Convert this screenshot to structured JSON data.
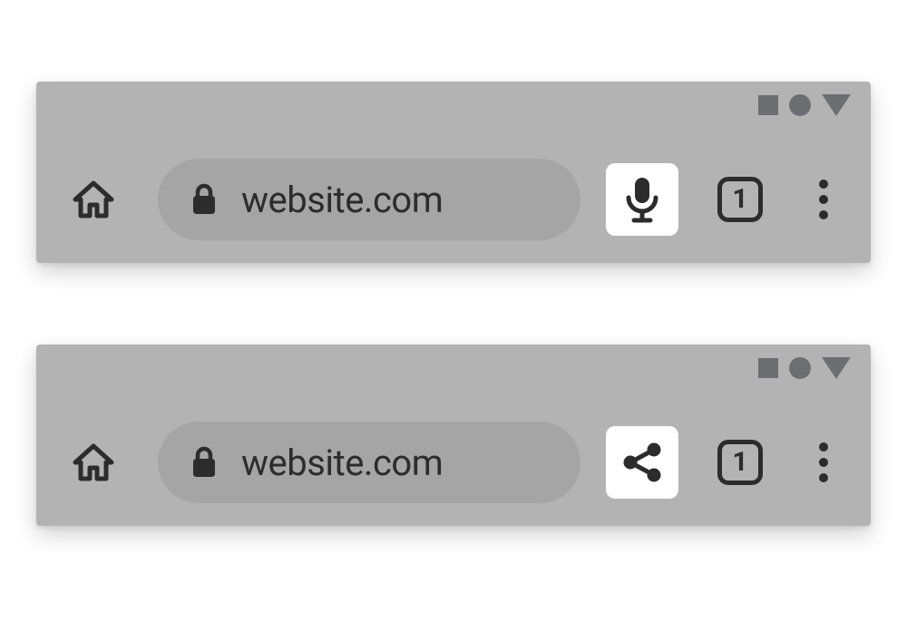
{
  "toolbars": [
    {
      "url": "website.com",
      "tab_count": "1",
      "action_icon": "microphone-icon"
    },
    {
      "url": "website.com",
      "tab_count": "1",
      "action_icon": "share-icon"
    }
  ],
  "colors": {
    "toolbar_bg": "#b3b3b3",
    "omnibox_bg": "#a5a5a5",
    "icon_dark": "#2c2c2c",
    "status_icon": "#6d6e71",
    "action_bg": "#ffffff"
  }
}
